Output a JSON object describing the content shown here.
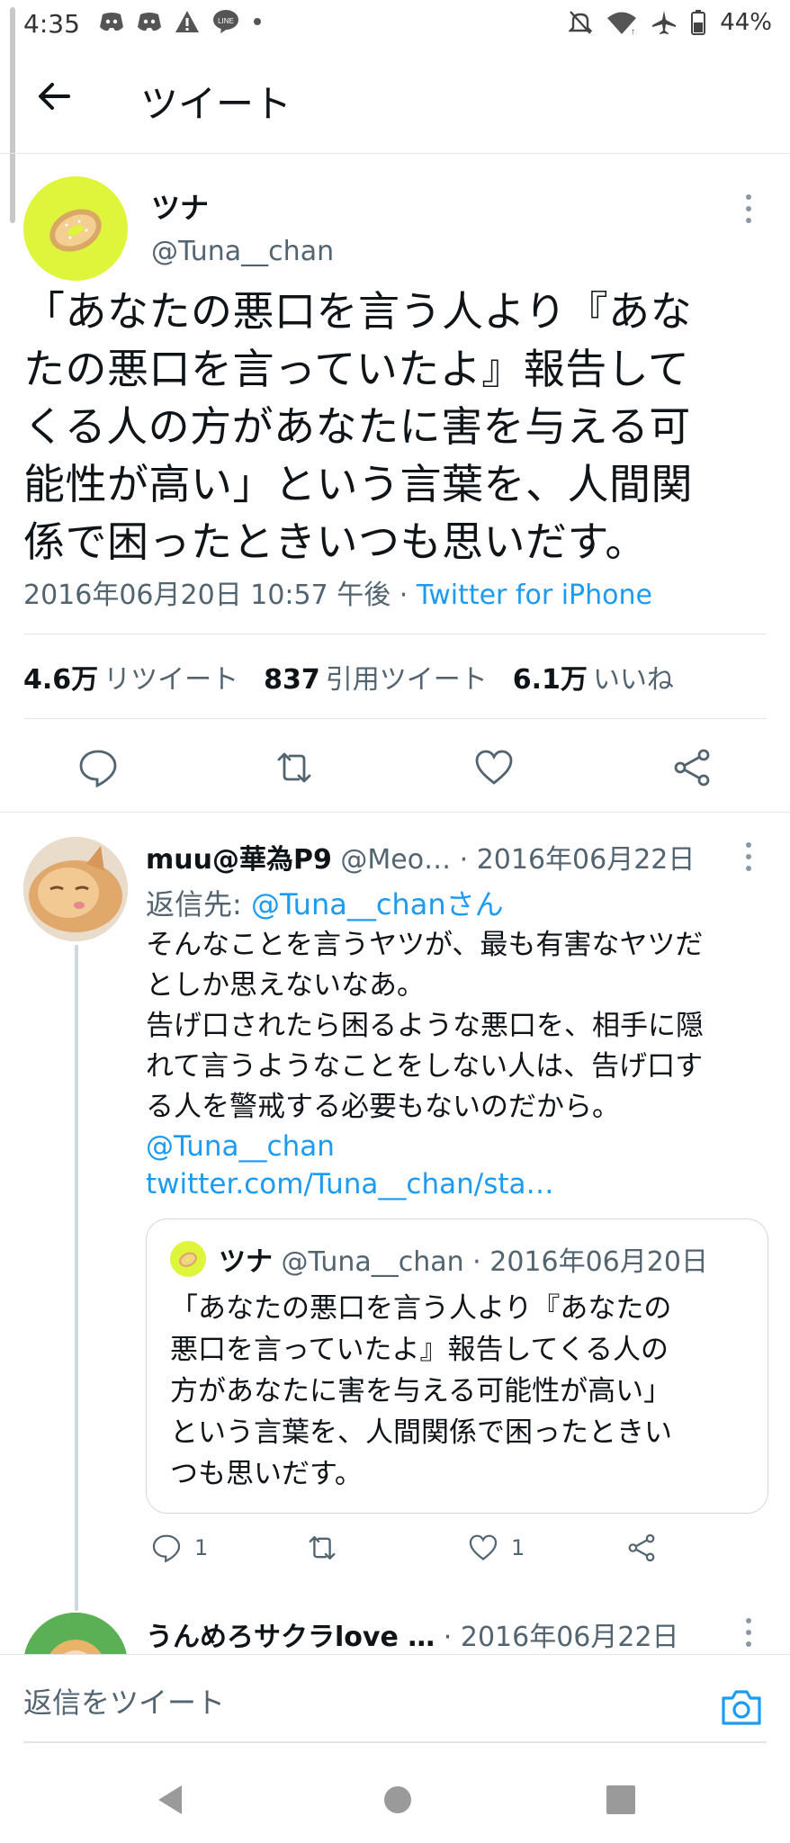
{
  "status_bar": {
    "time": "4:35",
    "battery": "44%",
    "icons_left": [
      "discord-icon",
      "discord-icon",
      "warning-icon",
      "line-icon",
      "dot-icon"
    ],
    "icons_right": [
      "mute-icon",
      "wifi-icon",
      "airplane-icon",
      "battery-icon"
    ]
  },
  "header": {
    "title": "ツイート"
  },
  "main_tweet": {
    "author_name": "ツナ",
    "author_handle": "@Tuna__chan",
    "text": "「あなたの悪口を言う人より『あな\nたの悪口を言っていたよ』報告して\nくる人の方があなたに害を与える可\n能性が高い」という言葉を、人間関\n係で困ったときいつも思いだす。",
    "timestamp": "2016年06月20日 10:57 午後",
    "separator": " · ",
    "source": "Twitter for iPhone",
    "stats": [
      {
        "count": "4.6万",
        "label": "リツイート"
      },
      {
        "count": "837",
        "label": "引用ツイート"
      },
      {
        "count": "6.1万",
        "label": "いいね"
      }
    ]
  },
  "reply_tweet": {
    "author_name": "muu@華為P9",
    "author_handle": "@Meo…",
    "date": " · 2016年06月22日",
    "reply_to_prefix": "返信先: ",
    "reply_to_link": "@Tuna__chanさん",
    "text": "そんなことを言うヤツが、最も有害なヤツだ\nとしか思えないなあ。\n告げ口されたら困るような悪口を、相手に隠\nれて言うようなことをしない人は、告げ口す\nる人を警戒する必要もないのだから。",
    "mention": "@Tuna__chan",
    "url": "twitter.com/Tuna__chan/sta…",
    "reply_count": "1",
    "like_count": "1"
  },
  "quoted_tweet": {
    "author_name": "ツナ",
    "author_handle": "@Tuna__chan",
    "date": " · 2016年06月20日",
    "text": "「あなたの悪口を言う人より『あなたの\n悪口を言っていたよ』報告してくる人の\n方があなたに害を与える可能性が高い」\nという言葉を、人間関係で困ったときい\nつも思いだす。"
  },
  "next_reply": {
    "author_name": "うんめろサクラlove …",
    "date": " · 2016年06月22日"
  },
  "reply_bar": {
    "placeholder": "返信をツイート"
  },
  "colors": {
    "link": "#1d9bf0",
    "muted": "#536471",
    "text": "#0f1419",
    "divider": "#e1e6ea"
  }
}
